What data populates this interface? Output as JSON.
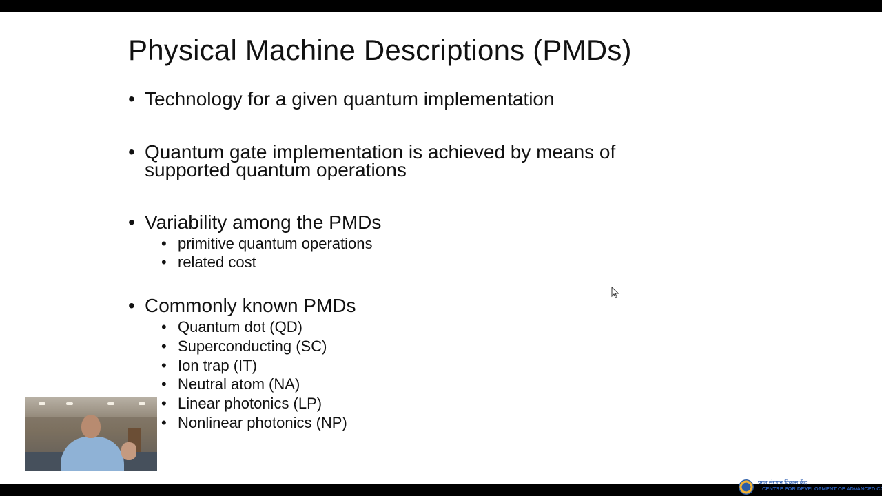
{
  "slide": {
    "title": "Physical Machine Descriptions (PMDs)",
    "bullet_glyph": "•",
    "bullets": [
      {
        "text": "Technology for a given quantum implementation"
      },
      {
        "line1": "Quantum gate implementation is achieved by means of",
        "line2": "supported quantum operations"
      },
      {
        "text": "Variability among the PMDs",
        "sub": [
          "primitive quantum operations",
          "related cost"
        ]
      },
      {
        "text": "Commonly known PMDs",
        "sub": [
          "Quantum dot (QD)",
          "Superconducting (SC)",
          "Ion trap (IT)",
          "Neutral atom (NA)",
          "Linear photonics (LP)",
          "Nonlinear photonics (NP)"
        ]
      }
    ]
  },
  "footer_logo": {
    "line1": "प्रगत संगणन विकास केंद्र",
    "line2": "CENTRE FOR DEVELOPMENT OF ADVANCED COMPUTING"
  },
  "colors": {
    "slide_bg": "#ffffff",
    "text": "#111111",
    "logo_blue": "#2a5bb0",
    "frame": "#000000"
  }
}
